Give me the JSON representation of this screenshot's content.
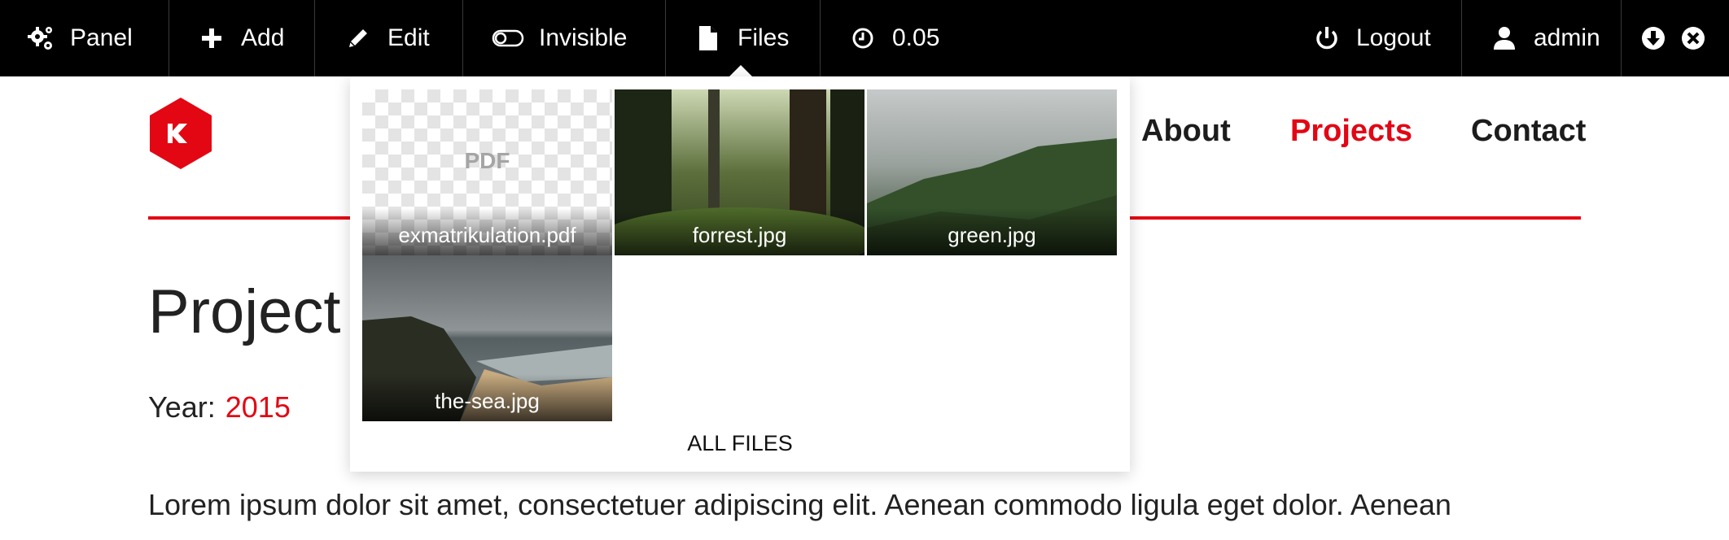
{
  "toolbar": {
    "panel": "Panel",
    "add": "Add",
    "edit": "Edit",
    "invisible": "Invisible",
    "files": "Files",
    "timer": "0.05",
    "logout": "Logout",
    "user": "admin",
    "icons": [
      "gears-icon",
      "plus-icon",
      "pencil-icon",
      "toggle-icon",
      "file-icon",
      "clock-icon",
      "power-icon",
      "user-icon",
      "download-circle-icon",
      "close-circle-icon"
    ]
  },
  "site": {
    "brand_color": "#e30613",
    "nav": [
      {
        "label": "About",
        "active": false
      },
      {
        "label": "Projects",
        "active": true
      },
      {
        "label": "Contact",
        "active": false
      }
    ]
  },
  "content": {
    "title": "Project",
    "year_label": "Year:",
    "year_value": "2015",
    "intro": "Lorem ipsum dolor sit amet, consectetuer adipiscing elit. Aenean commodo ligula eget dolor. Aenean"
  },
  "files_dropdown": {
    "files": [
      {
        "name": "exmatrikulation.pdf",
        "type_label": "PDF"
      },
      {
        "name": "forrest.jpg"
      },
      {
        "name": "green.jpg"
      },
      {
        "name": "the-sea.jpg"
      }
    ],
    "all_files_label": "ALL FILES"
  }
}
